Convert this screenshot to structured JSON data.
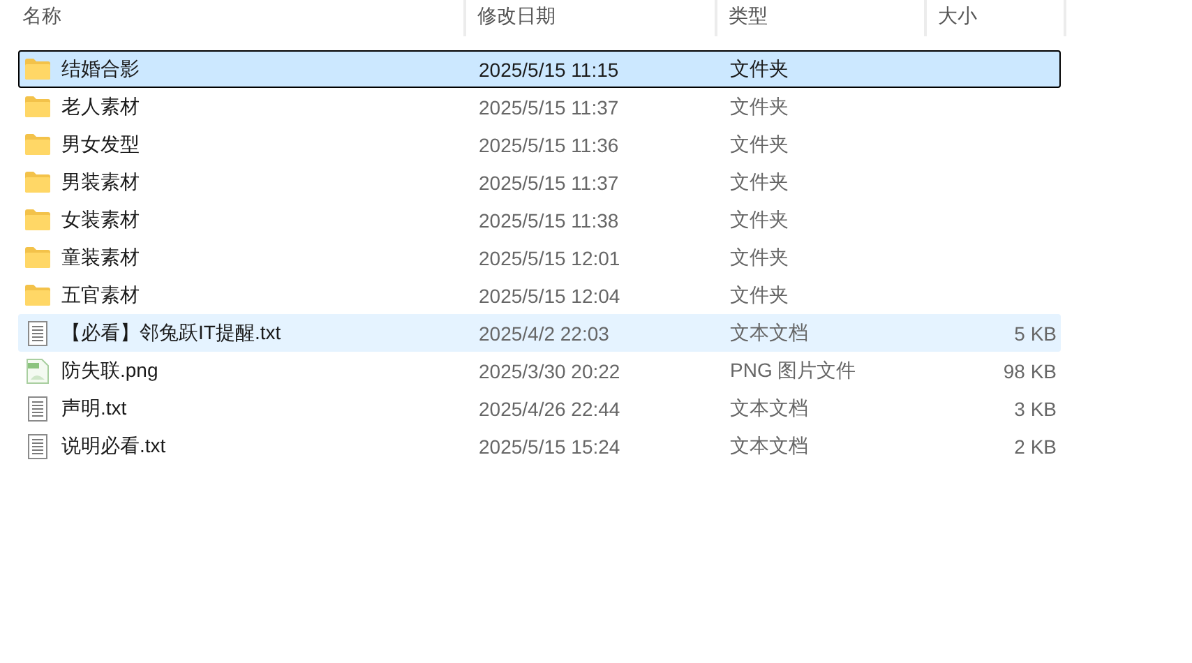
{
  "columns": [
    "名称",
    "修改日期",
    "类型",
    "大小"
  ],
  "files": [
    {
      "name": "结婚合影",
      "modified": "2025/5/15 11:15",
      "type": "文件夹",
      "kind": "folder",
      "selected": true,
      "hovered": false
    },
    {
      "name": "老人素材",
      "modified": "2025/5/15 11:37",
      "type": "文件夹",
      "kind": "folder",
      "selected": false,
      "hovered": false
    },
    {
      "name": "男女发型",
      "modified": "2025/5/15 11:36",
      "type": "文件夹",
      "kind": "folder",
      "selected": false,
      "hovered": false
    },
    {
      "name": "男装素材",
      "modified": "2025/5/15 11:37",
      "type": "文件夹",
      "kind": "folder",
      "selected": false,
      "hovered": false
    },
    {
      "name": "女装素材",
      "modified": "2025/5/15 11:38",
      "type": "文件夹",
      "kind": "folder",
      "selected": false,
      "hovered": false
    },
    {
      "name": "童装素材",
      "modified": "2025/5/15 12:01",
      "type": "文件夹",
      "kind": "folder",
      "selected": false,
      "hovered": false
    },
    {
      "name": "五官素材",
      "modified": "2025/5/15 12:04",
      "type": "文件夹",
      "kind": "folder",
      "selected": false,
      "hovered": false
    },
    {
      "name": "【必看】邻兔跃IT提醒.txt",
      "modified": "2025/4/2 22:03",
      "type": "文本文档",
      "size": "5 KB",
      "kind": "text",
      "selected": false,
      "hovered": true
    },
    {
      "name": "防失联.png",
      "modified": "2025/3/30 20:22",
      "type": "PNG 图片文件",
      "size": "98 KB",
      "kind": "image",
      "selected": false,
      "hovered": false
    },
    {
      "name": "声明.txt",
      "modified": "2025/4/26 22:44",
      "type": "文本文档",
      "size": "3 KB",
      "kind": "text",
      "selected": false,
      "hovered": false
    },
    {
      "name": "说明必看.txt",
      "modified": "2025/5/15 15:24",
      "type": "文本文档",
      "size": "2 KB",
      "kind": "text",
      "selected": false,
      "hovered": false
    }
  ]
}
